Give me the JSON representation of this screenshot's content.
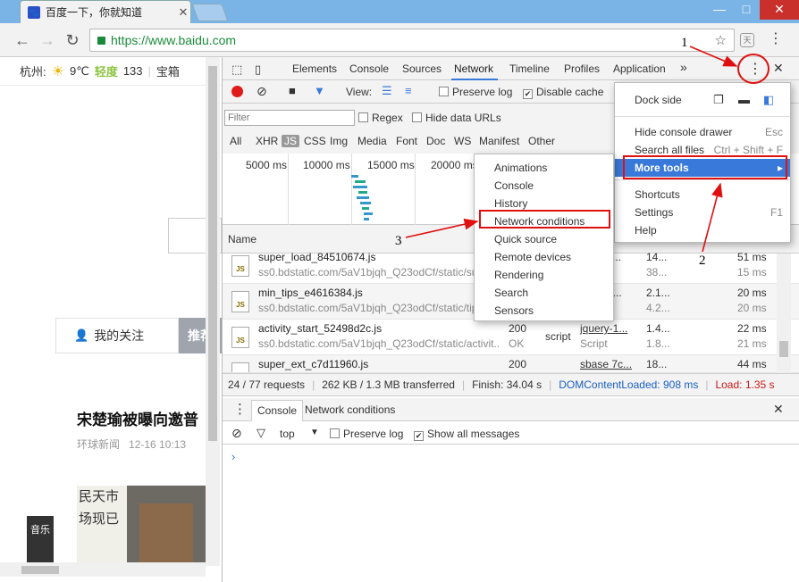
{
  "browser": {
    "tab_title": "百度一下，你就知道",
    "url": "https://www.baidu.com",
    "window_buttons": {
      "minimize": "—",
      "maximize": "□",
      "close": "✕"
    },
    "nav_icons": {
      "back": "←",
      "forward": "→",
      "reload": "↻"
    },
    "star": "☆",
    "menu_dots": "⋮",
    "ext_label": "天"
  },
  "page": {
    "city": "杭州:",
    "temperature": "9℃",
    "aqi_label": "轻度",
    "aqi_value": "133",
    "divider": "|",
    "link": "宝箱",
    "my_follow": "我的关注",
    "recommend": "推荐",
    "headline": "宋楚瑜被曝向邀普",
    "news_source": "环球新闻",
    "news_time": "12-16 10:13",
    "banner_text": "民天市场现已",
    "music_button": "音乐"
  },
  "devtools": {
    "tabs": [
      "Elements",
      "Console",
      "Sources",
      "Network",
      "Timeline",
      "Profiles",
      "Application"
    ],
    "more_tabs": "»",
    "toolbar": {
      "view_label": "View:",
      "preserve_log": "Preserve log",
      "disable_cache": "Disable cache"
    },
    "filter": {
      "placeholder": "Filter",
      "regex": "Regex",
      "hide_data_urls": "Hide data URLs",
      "types": [
        "All",
        "XHR",
        "JS",
        "CSS",
        "Img",
        "Media",
        "Font",
        "Doc",
        "WS",
        "Manifest",
        "Other"
      ]
    },
    "overview_ticks": [
      "5000 ms",
      "10000 ms",
      "15000 ms",
      "20000 ms"
    ],
    "name_header": "Name",
    "requests": [
      {
        "name": "super_load_84510674.js",
        "path": "ss0.bdstatic.com/5aV1bjqh_Q23odCf/static/su",
        "status": "",
        "status_sub": "",
        "type": "",
        "initiator": "c...",
        "size": "14...",
        "size_sub": "38...",
        "time": "51 ms",
        "time_sub": "15 ms"
      },
      {
        "name": "min_tips_e4616384.js",
        "path": "ss0.bdstatic.com/5aV1bjqh_Q23odCf/static/tip",
        "status": "",
        "status_sub": "",
        "type": "",
        "initiator": "1...",
        "size": "2.1...",
        "size_sub": "4.2...",
        "time": "20 ms",
        "time_sub": "20 ms"
      },
      {
        "name": "activity_start_52498d2c.js",
        "path": "ss0.bdstatic.com/5aV1bjqh_Q23odCf/static/activit...",
        "status": "200",
        "status_sub": "OK",
        "type": "script",
        "initiator": "jquery-1...",
        "initiator_sub": "Script",
        "size": "1.4...",
        "size_sub": "1.8...",
        "time": "22 ms",
        "time_sub": "21 ms"
      },
      {
        "name": "super_ext_c7d11960.js",
        "path": "",
        "status": "200",
        "status_sub": "",
        "type": "",
        "initiator": "sbase 7c...",
        "size": "18...",
        "size_sub": "",
        "time": "44 ms",
        "time_sub": ""
      }
    ],
    "status": {
      "requests": "24 / 77 requests",
      "transferred": "262 KB / 1.3 MB transferred",
      "finish": "Finish: 34.04 s",
      "dcl": "DOMContentLoaded: 908 ms",
      "load": "Load: 1.35 s"
    },
    "drawer": {
      "console_tab": "Console",
      "network_conditions_tab": "Network conditions",
      "context": "top",
      "preserve_log": "Preserve log",
      "show_all": "Show all messages",
      "prompt": "›"
    },
    "main_menu": {
      "dock_side": "Dock side",
      "items": [
        {
          "label": "Hide console drawer",
          "key": "Esc"
        },
        {
          "label": "Search all files",
          "key": "Ctrl + Shift + F"
        },
        {
          "label": "More tools",
          "key": "▸"
        },
        {
          "label": "Shortcuts",
          "key": ""
        },
        {
          "label": "Settings",
          "key": "F1"
        },
        {
          "label": "Help",
          "key": ""
        }
      ]
    },
    "more_tools_menu": [
      "Animations",
      "Console",
      "History",
      "Network conditions",
      "Quick source",
      "Remote devices",
      "Rendering",
      "Search",
      "Sensors"
    ]
  },
  "annotations": {
    "one": "1",
    "two": "2",
    "three": "3",
    "color": "#e01010"
  }
}
